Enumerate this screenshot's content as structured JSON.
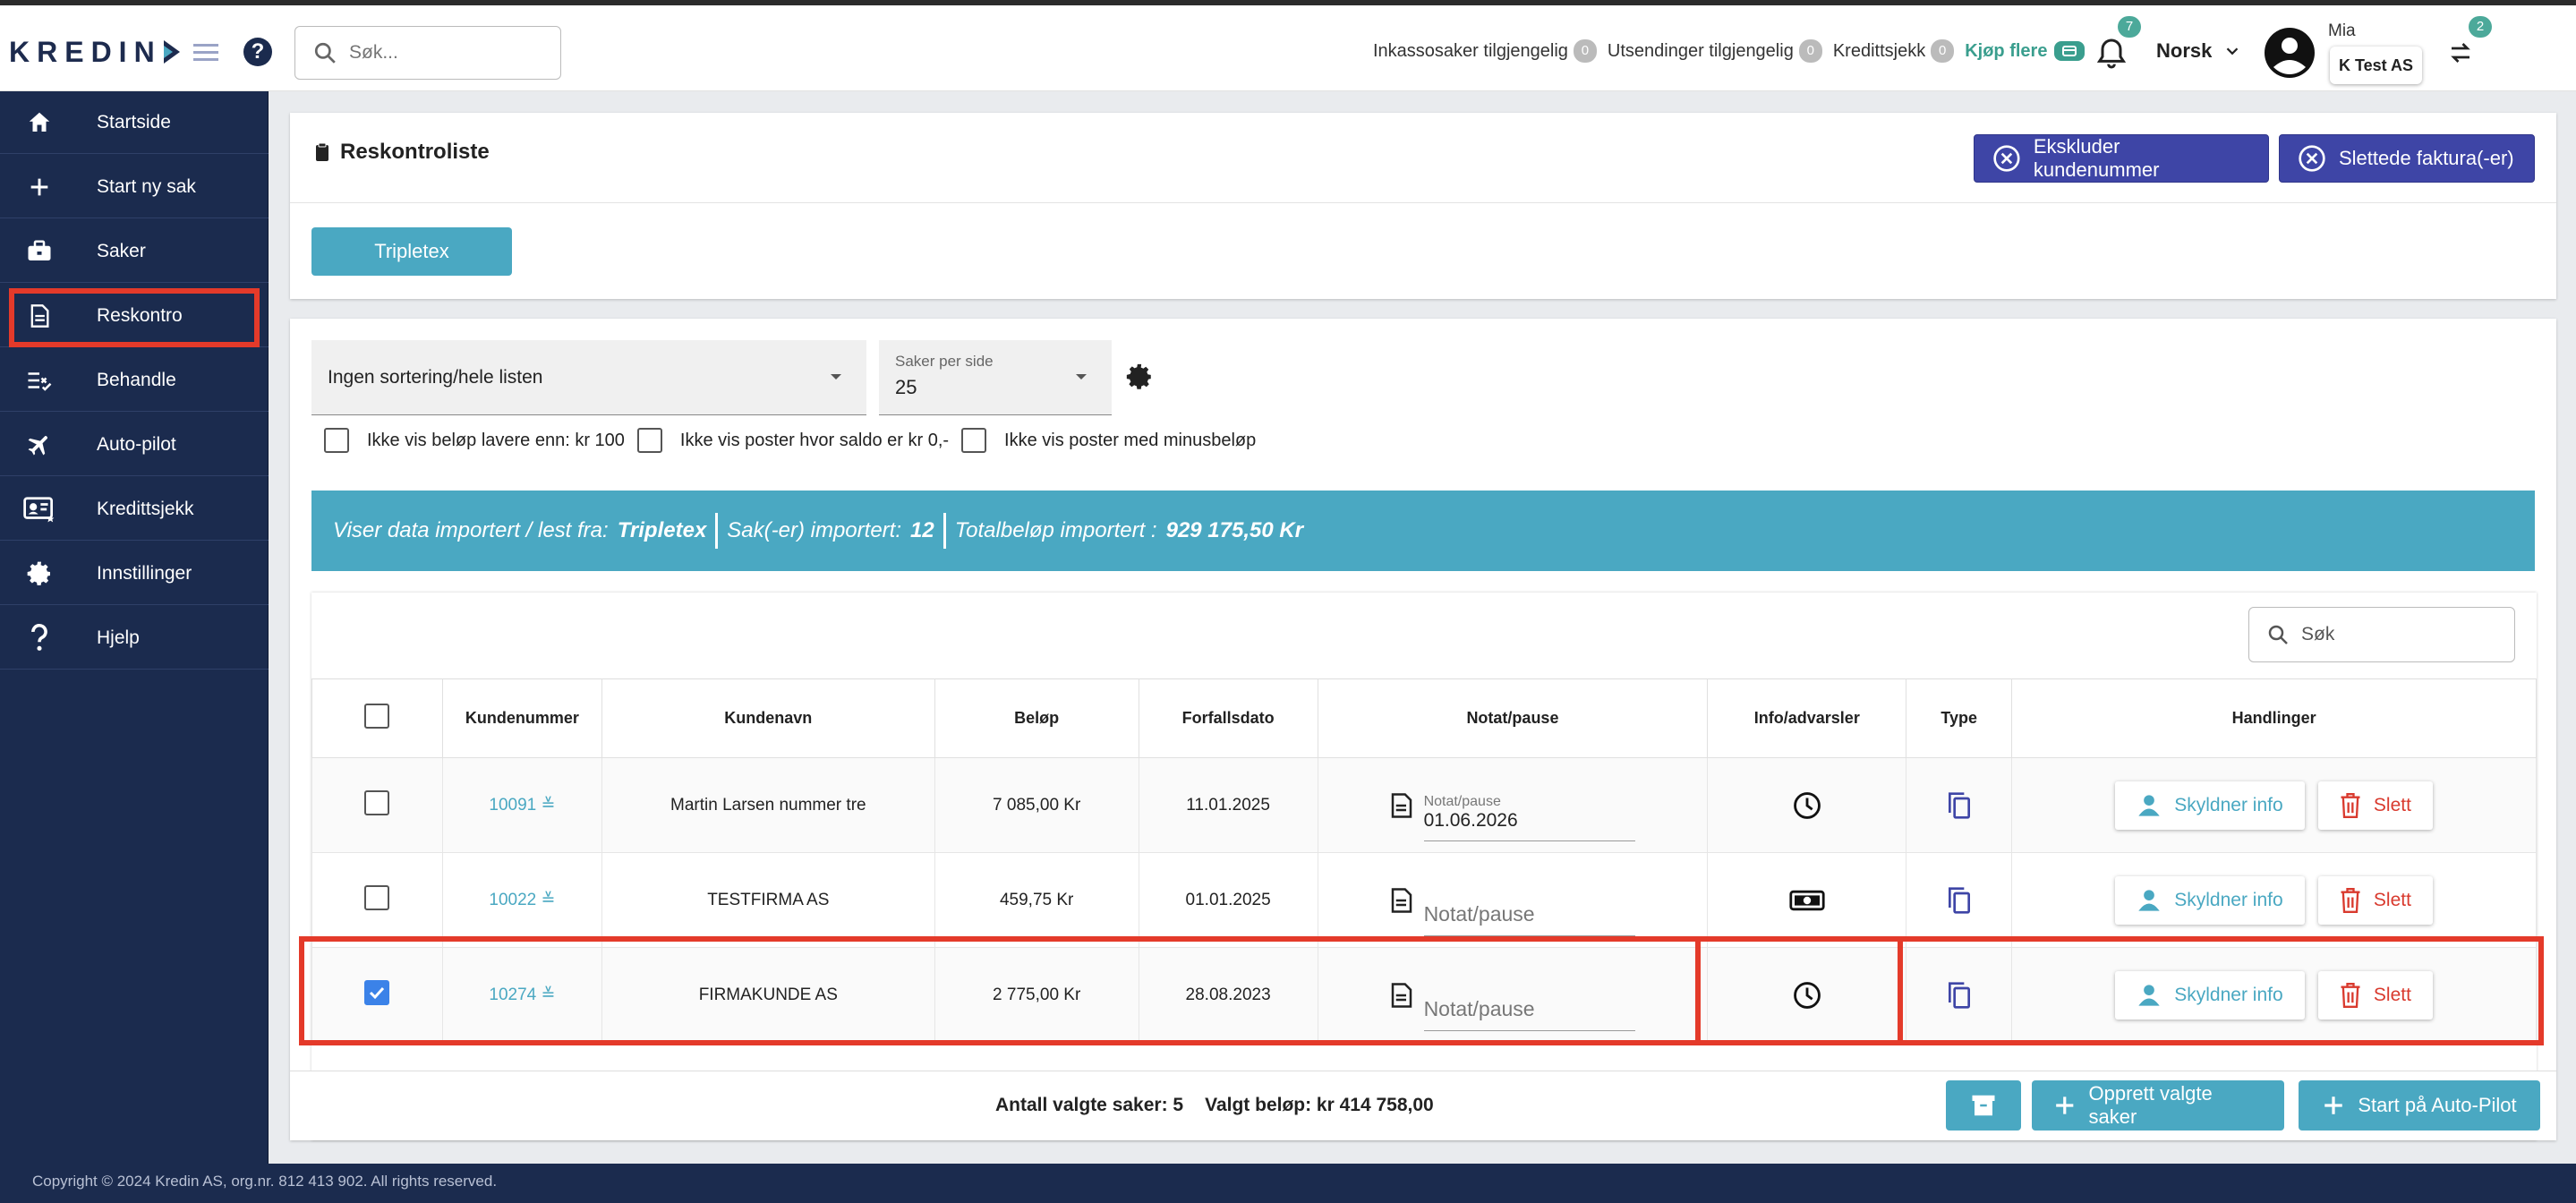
{
  "header": {
    "logo": "KREDIN",
    "search_placeholder": "Søk...",
    "counters": [
      {
        "label": "Inkassosaker tilgjengelig",
        "count": "0"
      },
      {
        "label": "Utsendinger tilgjengelig",
        "count": "0"
      },
      {
        "label": "Kredittsjekk",
        "count": "0"
      }
    ],
    "buy_more": "Kjøp flere",
    "notifications": "7",
    "language": "Norsk",
    "user_name": "Mia",
    "company": "K Test AS",
    "switch_count": "2"
  },
  "sidebar": {
    "items": [
      {
        "label": "Startside",
        "icon": "home-icon"
      },
      {
        "label": "Start ny sak",
        "icon": "plus-icon"
      },
      {
        "label": "Saker",
        "icon": "briefcase-icon"
      },
      {
        "label": "Reskontro",
        "icon": "document-icon"
      },
      {
        "label": "Behandle",
        "icon": "checklist-icon"
      },
      {
        "label": "Auto-pilot",
        "icon": "airplane-icon"
      },
      {
        "label": "Kredittsjekk",
        "icon": "id-card-icon"
      },
      {
        "label": "Innstillinger",
        "icon": "gear-icon"
      },
      {
        "label": "Hjelp",
        "icon": "question-icon"
      }
    ],
    "active": "Reskontro"
  },
  "page": {
    "title": "Reskontroliste",
    "exclude_btn": "Ekskluder kundenummer",
    "deleted_btn": "Slettede faktura(-er)",
    "source_btn": "Tripletex"
  },
  "controls": {
    "sort": "Ingen sortering/hele listen",
    "per_page_label": "Saker per side",
    "per_page_value": "25",
    "filters": [
      "Ikke vis beløp lavere enn: kr 100",
      "Ikke vis poster hvor saldo er kr 0,-",
      "Ikke vis poster med minusbeløp"
    ]
  },
  "banner": {
    "source_label": "Viser data importert / lest fra:",
    "source": "Tripletex",
    "count_label": "Sak(-er) importert:",
    "count": "12",
    "total_label": "Totalbeløp importert :",
    "total": "929 175,50 Kr"
  },
  "table": {
    "search_placeholder": "Søk",
    "headers": [
      "Kundenummer",
      "Kundenavn",
      "Beløp",
      "Forfallsdato",
      "Notat/pause",
      "Info/advarsler",
      "Type",
      "Handlinger"
    ],
    "rows": [
      {
        "kundenr": "10091",
        "name": "Martin Larsen nummer tre",
        "amount": "7 085,00 Kr",
        "due": "11.01.2025",
        "note_label": "Notat/pause",
        "note": "01.06.2026",
        "info_icon": "clock-icon",
        "checked": false
      },
      {
        "kundenr": "10022",
        "name": "TESTFIRMA AS",
        "amount": "459,75 Kr",
        "due": "01.01.2025",
        "note_label": "",
        "note": "Notat/pause",
        "info_icon": "money-icon",
        "checked": false
      },
      {
        "kundenr": "10274",
        "name": "FIRMAKUNDE AS",
        "amount": "2 775,00 Kr",
        "due": "28.08.2023",
        "note_label": "",
        "note": "Notat/pause",
        "info_icon": "clock-icon",
        "checked": true
      }
    ],
    "action_info": "Skyldner info",
    "action_delete": "Slett"
  },
  "footer": {
    "selected_count": "Antall valgte saker: 5",
    "selected_amount": "Valgt beløp: kr 414 758,00",
    "create_btn": "Opprett valgte saker",
    "autopilot_btn": "Start på Auto-Pilot",
    "copyright": "Copyright © 2024 Kredin AS, org.nr. 812 413 902. All rights reserved."
  },
  "colors": {
    "navy": "#1b2b4e",
    "teal": "#4aa8c2",
    "indigo": "#3e45a6",
    "highlight": "#e43a2a",
    "delete": "#d93a2e"
  }
}
